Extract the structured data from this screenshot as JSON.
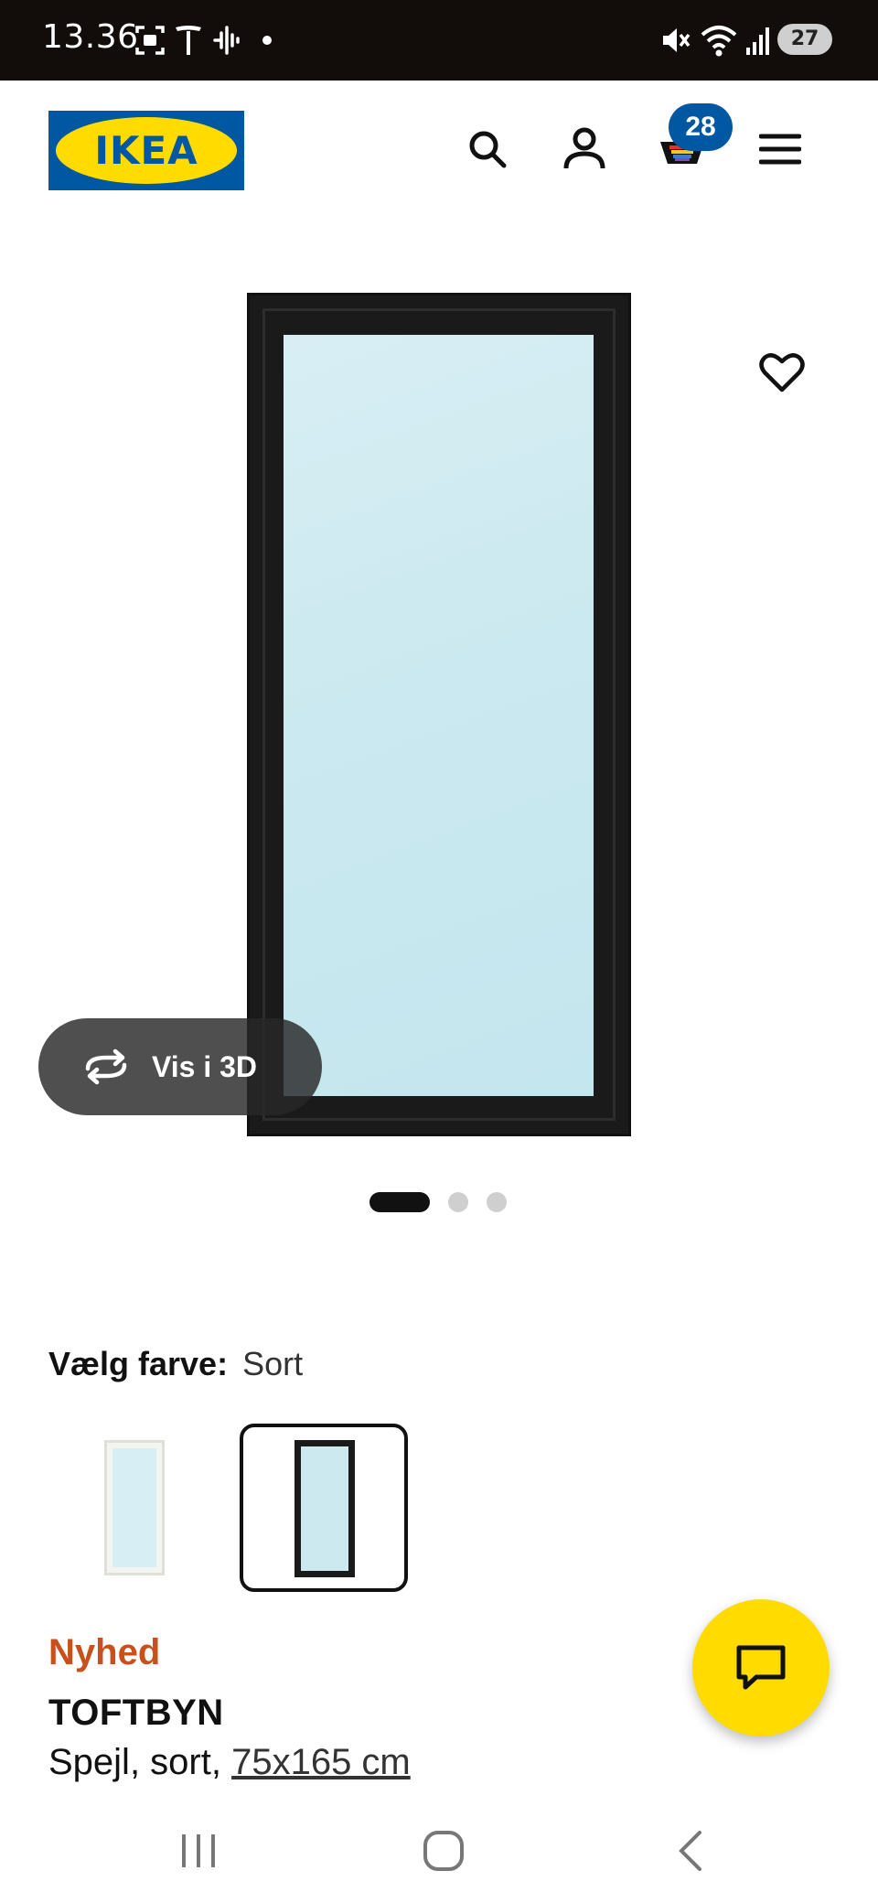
{
  "status_bar": {
    "time": "13.36",
    "battery": "27",
    "icons": [
      "screenshot-icon",
      "tesla-icon",
      "audio-wave-icon",
      "dot-icon",
      "mute-icon",
      "wifi-icon",
      "signal-icon"
    ]
  },
  "header": {
    "logo_text": "IKEA",
    "cart_count": "28",
    "icons": [
      "search-icon",
      "account-icon",
      "cart-icon",
      "menu-icon"
    ]
  },
  "gallery": {
    "view_3d_label": "Vis i 3D",
    "slide_count": 3,
    "active_slide": 1
  },
  "color_selector": {
    "label": "Vælg farve:",
    "selected_value": "Sort",
    "options": [
      "hvid",
      "sort"
    ],
    "selected_index": 1
  },
  "product": {
    "badge": "Nyhed",
    "name": "TOFTBYN",
    "description_prefix": "Spejl, sort, ",
    "size_link": "75x165 cm"
  },
  "colors": {
    "brand_blue": "#0058a3",
    "brand_yellow": "#ffdb00",
    "new_badge": "#c8501a"
  }
}
